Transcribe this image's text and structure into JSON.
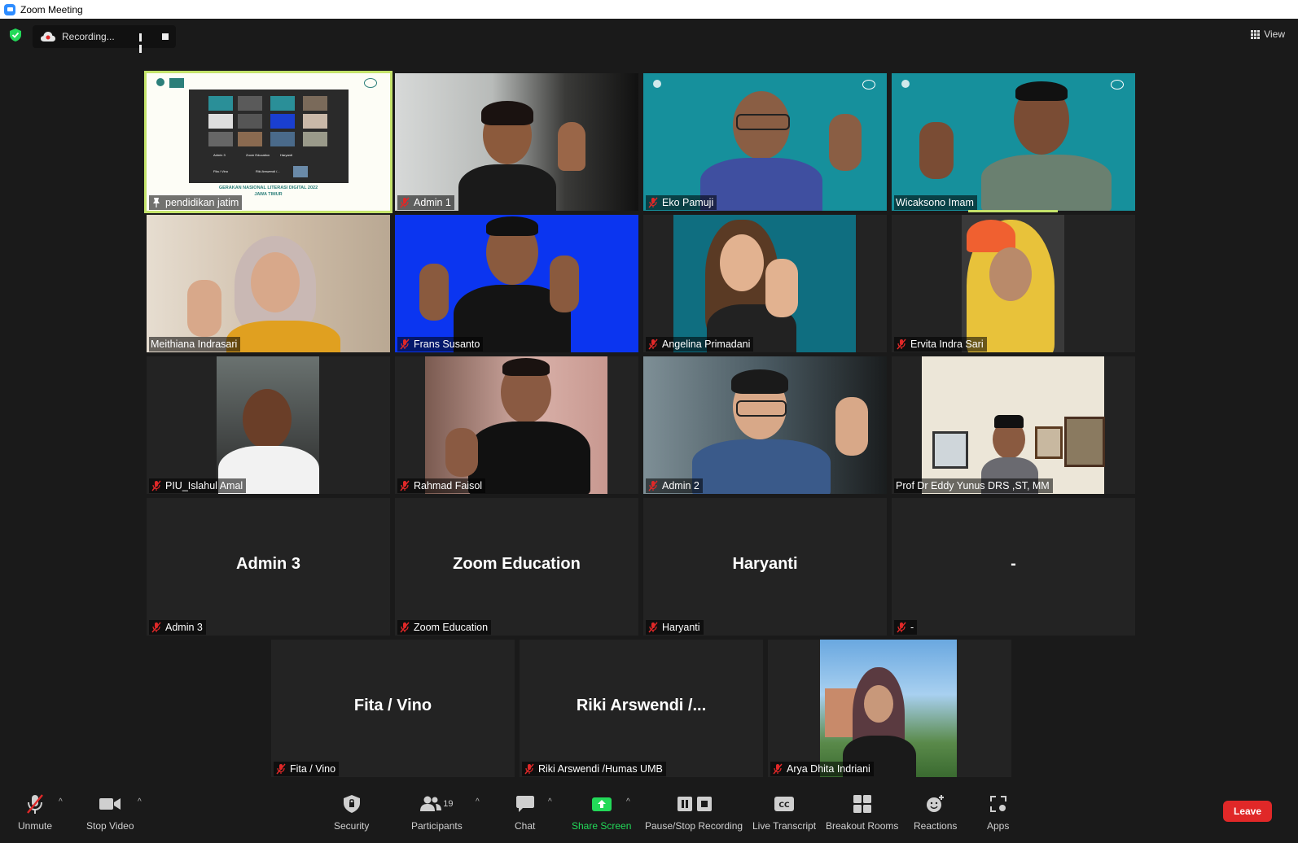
{
  "window": {
    "title": "Zoom Meeting"
  },
  "topbar": {
    "recording_label": "Recording...",
    "view_label": "View"
  },
  "tiles": [
    {
      "name": "pendidikan jatim",
      "display": "",
      "type": "share"
    },
    {
      "name": "Admin 1",
      "display": "",
      "type": "video"
    },
    {
      "name": "Eko Pamuji",
      "display": "",
      "type": "video"
    },
    {
      "name": "Wicaksono Imam",
      "display": "",
      "type": "video"
    },
    {
      "name": "Meithiana Indrasari",
      "display": "",
      "type": "video"
    },
    {
      "name": "Frans Susanto",
      "display": "",
      "type": "video"
    },
    {
      "name": "Angelina Primadani",
      "display": "",
      "type": "video"
    },
    {
      "name": "Ervita Indra Sari",
      "display": "",
      "type": "video"
    },
    {
      "name": "PIU_Islahul Amal",
      "display": "",
      "type": "video"
    },
    {
      "name": "Rahmad Faisol",
      "display": "",
      "type": "video"
    },
    {
      "name": "Admin 2",
      "display": "",
      "type": "video"
    },
    {
      "name": "Prof Dr Eddy Yunus DRS ,ST, MM",
      "display": "",
      "type": "video"
    },
    {
      "name": "Admin 3",
      "display": "Admin 3",
      "type": "name"
    },
    {
      "name": "Zoom Education",
      "display": "Zoom Education",
      "type": "name"
    },
    {
      "name": "Haryanti",
      "display": "Haryanti",
      "type": "name"
    },
    {
      "name": "-",
      "display": "-",
      "type": "name"
    },
    {
      "name": "Fita / Vino",
      "display": "Fita / Vino",
      "type": "name"
    },
    {
      "name": "Riki Arswendi /Humas UMB",
      "display": "Riki Arswendi /...",
      "type": "name"
    },
    {
      "name": "Arya Dhita Indriani",
      "display": "",
      "type": "video"
    }
  ],
  "slide": {
    "caption1": "GERAKAN NASIONAL LITERASI DIGITAL 2022",
    "caption2": "JAWA TIMUR",
    "mini_names": [
      "Admin 3",
      "Zoom Education",
      "Haryanti",
      "Fita / Vino",
      "Riki Arswendi /..."
    ]
  },
  "toolbar": {
    "unmute": "Unmute",
    "stop_video": "Stop Video",
    "security": "Security",
    "participants": "Participants",
    "participants_count": "19",
    "chat": "Chat",
    "share_screen": "Share Screen",
    "pause_stop_recording": "Pause/Stop Recording",
    "live_transcript": "Live Transcript",
    "breakout_rooms": "Breakout Rooms",
    "reactions": "Reactions",
    "apps": "Apps",
    "leave": "Leave"
  },
  "colors": {
    "active_speaker": "#c4e36b",
    "share_green": "#23d959",
    "leave_red": "#e02828",
    "muted_red": "#e02828"
  }
}
